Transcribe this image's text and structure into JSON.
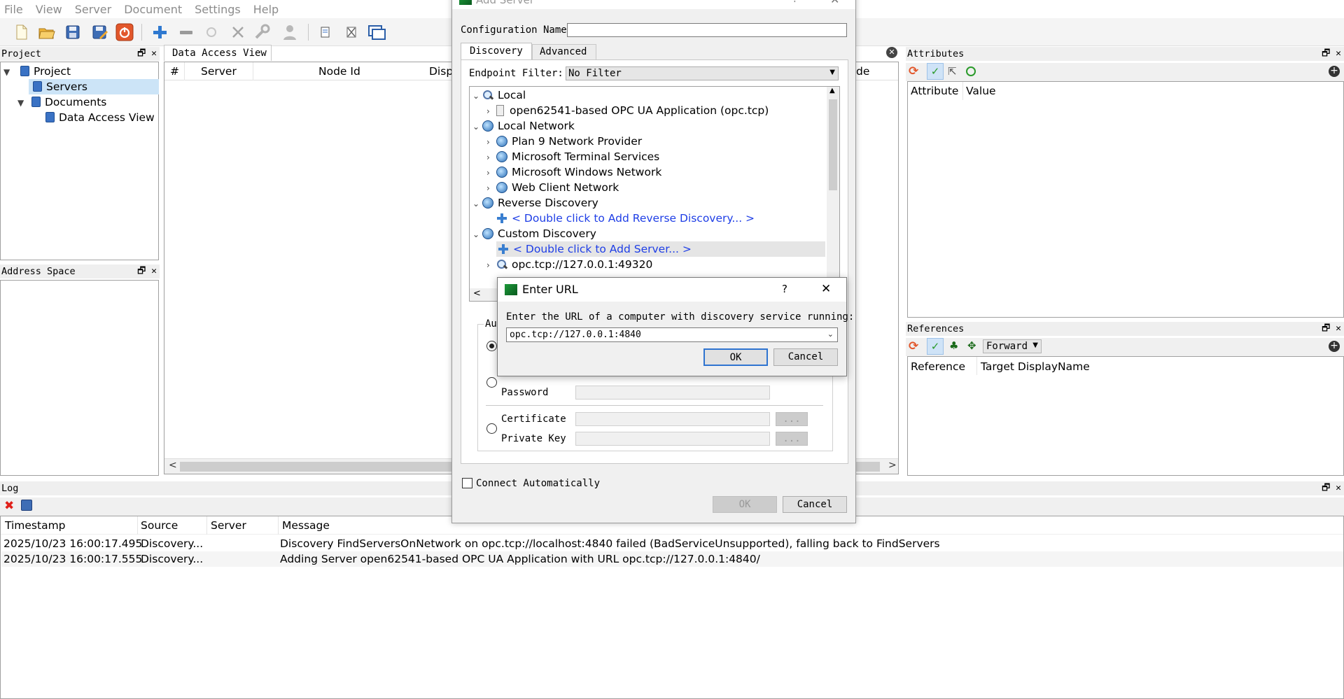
{
  "menu": [
    "File",
    "View",
    "Server",
    "Document",
    "Settings",
    "Help"
  ],
  "project_panel": {
    "title": "Project",
    "items": [
      {
        "label": "Project"
      },
      {
        "label": "Servers"
      },
      {
        "label": "Documents"
      },
      {
        "label": "Data Access View"
      }
    ]
  },
  "address_space_panel": {
    "title": "Address Space"
  },
  "data_access_view": {
    "tab": "Data Access View",
    "columns": [
      "#",
      "Server",
      "Node Id",
      "Displ",
      "de"
    ]
  },
  "attributes_panel": {
    "title": "Attributes",
    "columns": [
      "Attribute",
      "Value"
    ]
  },
  "references_panel": {
    "title": "References",
    "direction": "Forward",
    "columns": [
      "Reference",
      "Target DisplayName"
    ]
  },
  "log_panel": {
    "title": "Log",
    "columns": [
      "Timestamp",
      "Source",
      "Server",
      "Message"
    ],
    "rows": [
      {
        "timestamp": "2025/10/23 16:00:17.495",
        "source": "Discovery...",
        "server": "",
        "message": "Discovery FindServersOnNetwork on opc.tcp://localhost:4840 failed (BadServiceUnsupported), falling back to FindServers"
      },
      {
        "timestamp": "2025/10/23 16:00:17.555",
        "source": "Discovery...",
        "server": "",
        "message": "Adding Server open62541-based OPC UA Application with URL opc.tcp://127.0.0.1:4840/"
      }
    ]
  },
  "add_server_dialog": {
    "title": "Add Server",
    "title_help": "?",
    "config_name_label": "Configuration Name",
    "config_name_value": "",
    "tabs": [
      "Discovery",
      "Advanced"
    ],
    "endpoint_filter_label": "Endpoint Filter:",
    "endpoint_filter_value": "No Filter",
    "tree": [
      {
        "label": "Local",
        "level": 0
      },
      {
        "label": "open62541-based OPC UA Application (opc.tcp)",
        "level": 1
      },
      {
        "label": "Local Network",
        "level": 0
      },
      {
        "label": "Plan 9 Network Provider",
        "level": 1
      },
      {
        "label": "Microsoft Terminal Services",
        "level": 1
      },
      {
        "label": "Microsoft Windows Network",
        "level": 1
      },
      {
        "label": "Web Client Network",
        "level": 1
      },
      {
        "label": "Reverse Discovery",
        "level": 0
      },
      {
        "label": "< Double click to Add Reverse Discovery... >",
        "level": 1
      },
      {
        "label": "Custom Discovery",
        "level": 0
      },
      {
        "label": "< Double click to Add Server... >",
        "level": 1
      },
      {
        "label": "opc.tcp://127.0.0.1:49320",
        "level": 1
      }
    ],
    "auth_group_label": "Au",
    "password_label": "Password",
    "certificate_label": "Certificate",
    "private_key_label": "Private Key",
    "browse_label": "...",
    "connect_auto_label": "Connect Automatically",
    "ok_label": "OK",
    "cancel_label": "Cancel"
  },
  "enter_url_dialog": {
    "title": "Enter URL",
    "help": "?",
    "prompt": "Enter the URL of a computer with discovery service running:",
    "url_value": "opc.tcp://127.0.0.1:4840",
    "ok_label": "OK",
    "cancel_label": "Cancel"
  }
}
